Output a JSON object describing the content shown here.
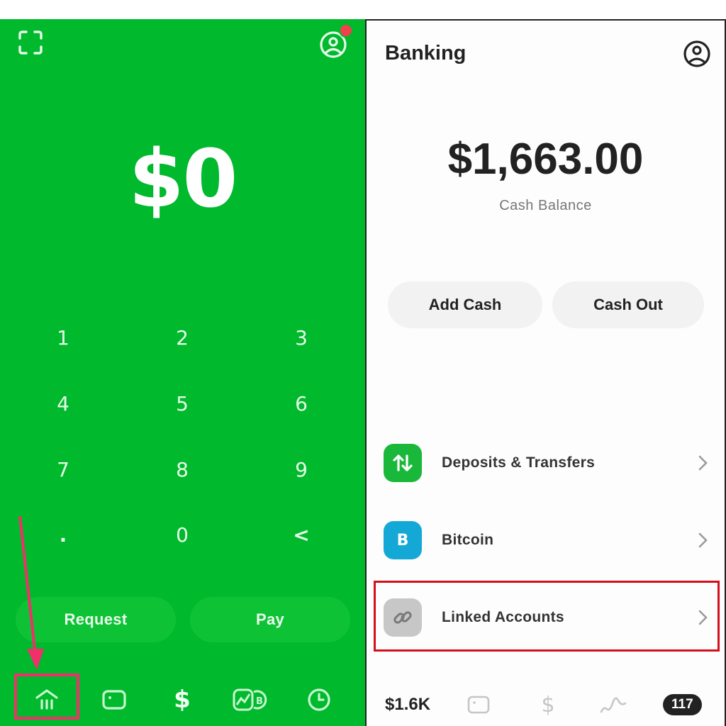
{
  "left_screen": {
    "amount": "$0",
    "keypad": [
      "1",
      "2",
      "3",
      "4",
      "5",
      "6",
      "7",
      "8",
      "9",
      ".",
      "0",
      "<"
    ],
    "actions": {
      "request_label": "Request",
      "pay_label": "Pay"
    },
    "icons": {
      "scan": "scan-icon",
      "profile": "profile-icon",
      "notification": "notification-dot"
    },
    "nav": [
      {
        "name": "banking",
        "icon": "bank-icon",
        "highlighted": true
      },
      {
        "name": "card",
        "icon": "card-icon"
      },
      {
        "name": "pay",
        "icon": "dollar-icon"
      },
      {
        "name": "investing",
        "icon": "investing-bitcoin-icon"
      },
      {
        "name": "activity",
        "icon": "clock-icon"
      }
    ],
    "annotation": {
      "color": "#f0306a",
      "type": "arrow-and-box"
    }
  },
  "right_screen": {
    "title": "Banking",
    "balance": "$1,663.00",
    "balance_label": "Cash Balance",
    "actions": {
      "add_cash_label": "Add Cash",
      "cash_out_label": "Cash Out"
    },
    "menu": [
      {
        "label": "Deposits & Transfers",
        "icon": "arrows-up-down-icon",
        "color": "#1ab83a"
      },
      {
        "label": "Bitcoin",
        "icon": "bitcoin-icon",
        "color": "#14a8d6"
      },
      {
        "label": "Linked Accounts",
        "icon": "link-icon",
        "color": "#c7c7c7",
        "highlighted": true
      }
    ],
    "nav": {
      "balance_short": "$1.6K",
      "items": [
        "card-icon",
        "dollar-icon",
        "investing-icon"
      ],
      "activity_badge": "117"
    },
    "annotation": {
      "color": "#d40f1b",
      "type": "box"
    }
  },
  "colors": {
    "brand_green": "#00b92d",
    "highlight_pink": "#f0306a",
    "highlight_red": "#d40f1b"
  }
}
